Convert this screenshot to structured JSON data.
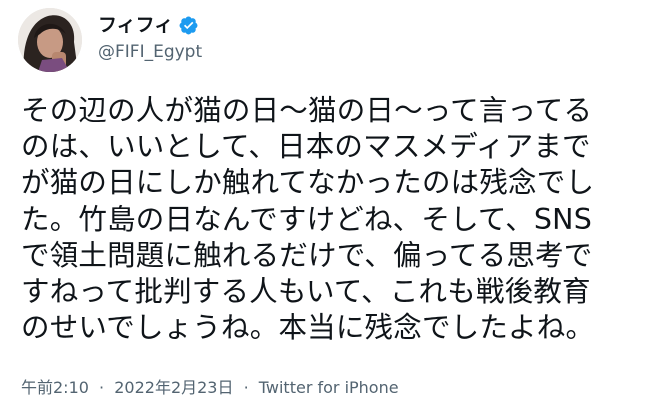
{
  "author": {
    "display_name": "フィフィ",
    "handle": "@FIFI_Egypt",
    "verified_icon": "verified-badge-icon",
    "badge_color": "#1d9bf0"
  },
  "tweet": {
    "lines": [
      "その辺の人が猫の日〜猫の日〜って言ってる",
      "のは、いいとして、日本のマスメディアまで",
      "が猫の日にしか触れてなかったのは残念でし",
      "た。竹島の日なんですけどね、そして、SNS",
      "で領土問題に触れるだけで、偏ってる思考で",
      "すねって批判する人もいて、これも戦後教育",
      "のせいでしょうね。本当に残念でしたよね。"
    ]
  },
  "meta": {
    "time": "午前2:10",
    "separator": "·",
    "date": "2022年2月23日",
    "source": "Twitter for iPhone"
  }
}
